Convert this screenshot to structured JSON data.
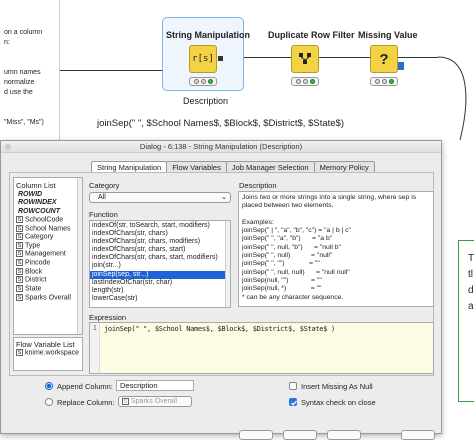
{
  "side_text": [
    "on a column",
    "n:",
    "",
    "",
    "umn names",
    "normalize",
    "d use the",
    "",
    "",
    "\"Miss\", \"Ms\")"
  ],
  "nodes": {
    "string_manipulation": {
      "title": "String Manipulation",
      "label": "Description"
    },
    "duplicate_row_filter": {
      "title": "Duplicate Row Filter"
    },
    "missing_value": {
      "title": "Missing Value"
    }
  },
  "workflow_expression": "joinSep(\" \", $School Names$, $Block$, $District$, $State$)",
  "right_letters": [
    "T",
    "tl",
    "di",
    "a"
  ],
  "dialog": {
    "title": "Dialog - 6:138 - String Manipulation (Description)",
    "tabs": [
      "String Manipulation",
      "Flow Variables",
      "Job Manager Selection",
      "Memory Policy"
    ],
    "column_list_label": "Column List",
    "columns": [
      {
        "badge": "",
        "name": "ROWID",
        "italic": true
      },
      {
        "badge": "",
        "name": "ROWINDEX",
        "italic": true
      },
      {
        "badge": "",
        "name": "ROWCOUNT",
        "italic": true
      },
      {
        "badge": "S",
        "name": "SchoolCode"
      },
      {
        "badge": "S",
        "name": "School Names"
      },
      {
        "badge": "S",
        "name": "Category"
      },
      {
        "badge": "S",
        "name": "Type"
      },
      {
        "badge": "S",
        "name": "Management"
      },
      {
        "badge": "S",
        "name": "Pincode"
      },
      {
        "badge": "S",
        "name": "Block"
      },
      {
        "badge": "S",
        "name": "District"
      },
      {
        "badge": "S",
        "name": "State"
      },
      {
        "badge": "S",
        "name": "Sparks Overall"
      }
    ],
    "flow_variable_label": "Flow Variable List",
    "flow_variables": [
      {
        "badge": "S",
        "name": "knime.workspace"
      }
    ],
    "category_label": "Category",
    "category_value": "All",
    "function_label": "Function",
    "functions": [
      "indexOf(str, toSearch, start, modifiers)",
      "indexOfChars(str, chars)",
      "indexOfChars(str, chars, modifiers)",
      "indexOfChars(str, chars, start)",
      "indexOfChars(str, chars, start, modifiers)",
      "join(str...)",
      "joinSep(sep, str...)",
      "lastIndexOfChar(str, char)",
      "length(str)",
      "lowerCase(str)"
    ],
    "selected_function_index": 6,
    "description_label": "Description",
    "description_lines": [
      "Joins two or more strings into a single string, where sep is",
      "placed between two elements.",
      "",
      "Examples:",
      "joinSep(\" | \", \"a\", \"b\", \"c\") = \"a | b | c\"",
      "joinSep(\" \", \"a\", \"b\")      = \"a b\"",
      "joinSep(\" \", null, \"b\")      = \"null b\"",
      "joinSep(\" \", null)           = \"null\"",
      "joinSep(\" \", \"\")             = \"\"",
      "joinSep(\" \", null, null)      = \"null null\"",
      "joinSep(null, \"\")            = \"\"",
      "joinSep(null, *)             = \"\"",
      "* can be any character sequence."
    ],
    "expression_label": "Expression",
    "expression_line_no": "1",
    "expression": "joinSep(\" \", $School Names$, $Block$, $District$, $State$ )",
    "append_label": "Append Column:",
    "append_value": "Description",
    "replace_label": "Replace Column:",
    "replace_badge": "S",
    "replace_value": "Sparks Overall",
    "insert_missing_label": "Insert Missing As Null",
    "syntax_check_label": "Syntax check on close",
    "append_selected": true,
    "insert_missing_checked": false,
    "syntax_check_checked": true
  }
}
